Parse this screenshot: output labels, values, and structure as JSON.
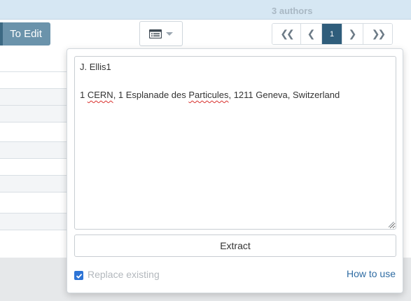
{
  "header": {
    "authors_count": "3 authors"
  },
  "toolbar": {
    "to_edit_label": "To Edit",
    "view_toggle_icon": "list-icon",
    "pager": {
      "first": "❮❮",
      "prev": "❮",
      "current": "1",
      "next": "❯",
      "last": "❯❯"
    }
  },
  "popover": {
    "textarea": {
      "line1": "J. Ellis1",
      "line3_prefix": "1 ",
      "line3_cern": "CERN",
      "line3_mid": ", 1 Esplanade des ",
      "line3_particules": "Particules",
      "line3_suffix": ", 1211 Geneva, Switzerland"
    },
    "extract_label": "Extract",
    "replace_existing_label": "Replace existing",
    "replace_existing_checked": true,
    "how_to_use_label": "How to use"
  },
  "colors": {
    "header_bg": "#d6e7f3",
    "to_edit_bg": "#6b93ab",
    "pager_active": "#2f5d7b",
    "link": "#2f6ca3",
    "checkbox": "#2d74d6"
  }
}
